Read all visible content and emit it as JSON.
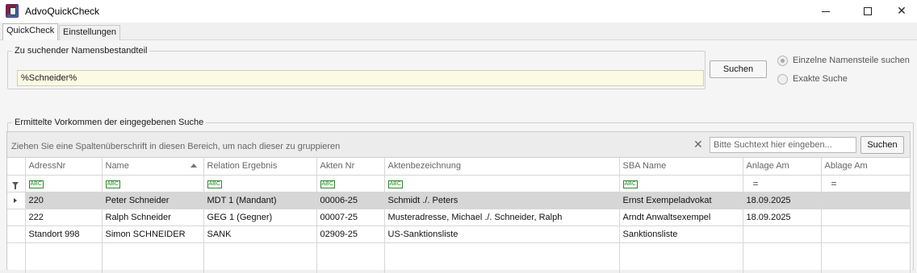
{
  "window": {
    "title": "AdvoQuickCheck",
    "controls": {
      "minimize": "",
      "maximize": "",
      "close": "✕"
    }
  },
  "tabs": [
    {
      "label": "QuickCheck",
      "active": true
    },
    {
      "label": "Einstellungen",
      "active": false
    }
  ],
  "search_group": {
    "legend": "Zu suchender Namensbestandteil",
    "input_value": "%Schneider%",
    "button_label": "Suchen",
    "options": [
      {
        "label": "Einzelne Namensteile suchen",
        "checked": true
      },
      {
        "label": "Exakte Suche",
        "checked": false
      }
    ]
  },
  "results_group": {
    "legend": "Ermittelte Vorkommen der eingegebenen Suche",
    "group_hint": "Ziehen Sie eine Spaltenüberschrift in diesen Bereich, um nach dieser zu gruppieren",
    "clear_icon": "✕",
    "search_placeholder": "Bitte Suchtext hier eingeben...",
    "search_button": "Suchen",
    "columns": [
      "AdressNr",
      "Name",
      "Relation Ergebnis",
      "Akten Nr",
      "Aktenbezeichnung",
      "SBA Name",
      "Anlage Am",
      "Ablage Am"
    ],
    "sorted_column": "Name",
    "filter_text_icon": "ABC",
    "filter_eq_icon": "=",
    "rows": [
      [
        "220",
        "Peter Schneider",
        "MDT 1 (Mandant)",
        "00006-25",
        "Schmidt ./. Peters",
        "Ernst Exempeladvokat",
        "18.09.2025",
        ""
      ],
      [
        "222",
        "Ralph Schneider",
        "GEG 1 (Gegner)",
        "00007-25",
        "Musteradresse, Michael ./. Schneider, Ralph",
        "Arndt Anwaltsexempel",
        "18.09.2025",
        ""
      ],
      [
        "Standort 998",
        "Simon SCHNEIDER",
        "SANK",
        "02909-25",
        "US-Sanktionsliste",
        "Sanktionsliste",
        "",
        ""
      ]
    ],
    "selected_row": 0
  },
  "colors": {
    "input_bg": "#fbfbe3",
    "selected_row": "#d6d6d6",
    "filter_icon": "#2a8a2a"
  }
}
